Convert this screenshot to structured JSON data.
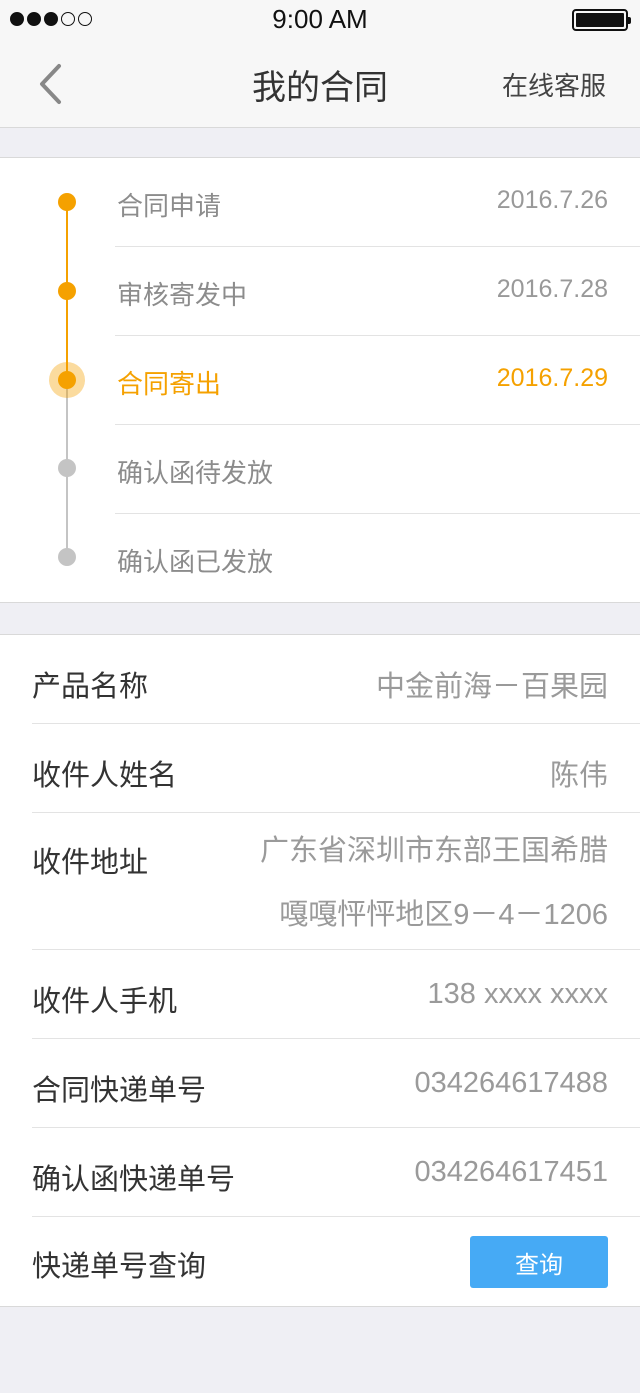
{
  "status_bar": {
    "time": "9:00 AM"
  },
  "nav": {
    "title": "我的合同",
    "right_action": "在线客服"
  },
  "timeline": [
    {
      "label": "合同申请",
      "date": "2016.7.26",
      "state": "done"
    },
    {
      "label": "审核寄发中",
      "date": "2016.7.28",
      "state": "done"
    },
    {
      "label": "合同寄出",
      "date": "2016.7.29",
      "state": "current"
    },
    {
      "label": "确认函待发放",
      "date": "",
      "state": "pending"
    },
    {
      "label": "确认函已发放",
      "date": "",
      "state": "pending"
    }
  ],
  "info": {
    "product_name": {
      "label": "产品名称",
      "value": "中金前海－百果园"
    },
    "recipient_name": {
      "label": "收件人姓名",
      "value": "陈伟"
    },
    "address": {
      "label": "收件地址",
      "line1": "广东省深圳市东部王国希腊",
      "line2": "嘎嘎怦怦地区9－4－1206"
    },
    "recipient_phone": {
      "label": "收件人手机",
      "value": "138 xxxx xxxx"
    },
    "contract_tracking": {
      "label": "合同快递单号",
      "value": "034264617488"
    },
    "confirm_tracking": {
      "label": "确认函快递单号",
      "value": "034264617451"
    },
    "tracking_query": {
      "label": "快递单号查询",
      "button": "查询"
    }
  },
  "colors": {
    "accent": "#f5a100",
    "pending": "#c4c4c4",
    "button": "#46aaf5"
  }
}
